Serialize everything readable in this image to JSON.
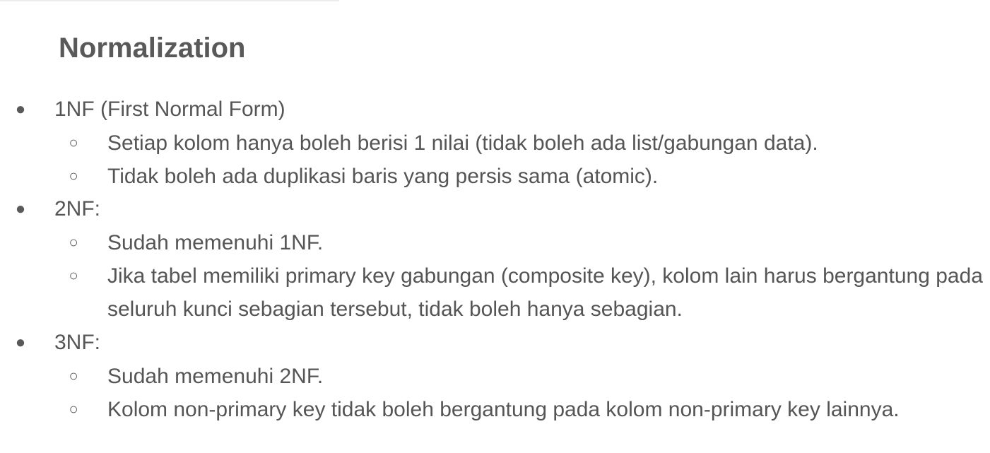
{
  "slide": {
    "title": "Normalization",
    "bullet_glyph": "●",
    "sub_bullet_glyph": "○",
    "sections": [
      {
        "heading": "1NF (First Normal Form)",
        "items": [
          "Setiap kolom hanya boleh berisi 1 nilai (tidak boleh ada list/gabungan data).",
          "Tidak boleh ada duplikasi baris yang persis sama (atomic)."
        ]
      },
      {
        "heading": "2NF:",
        "items": [
          "Sudah memenuhi 1NF.",
          "Jika tabel memiliki primary key gabungan (composite key), kolom lain harus bergantung pada seluruh kunci sebagian tersebut, tidak boleh hanya sebagian."
        ]
      },
      {
        "heading": "3NF:",
        "items": [
          "Sudah memenuhi 2NF.",
          "Kolom non-primary key tidak boleh bergantung pada kolom non-primary key lainnya."
        ]
      }
    ]
  }
}
